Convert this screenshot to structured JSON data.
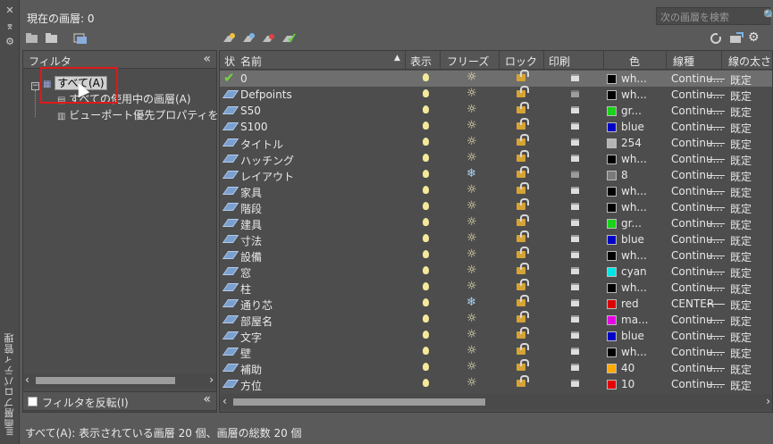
{
  "side_panel": {
    "title": "画層プロパティ管理"
  },
  "header": {
    "current_layer": "現在の画層: 0",
    "search_placeholder": "次の画層を検索"
  },
  "filter": {
    "title": "フィルタ",
    "tree": [
      {
        "label": "すべて(A)"
      },
      {
        "label": "すべての使用中の画層(A)"
      },
      {
        "label": "ビューポート優先プロパティを含む画"
      }
    ],
    "invert_label": "フィルタを反転(I)"
  },
  "columns": [
    "状",
    "名前",
    "表示",
    "フリーズ",
    "ロック",
    "印刷",
    "色",
    "線種",
    "線の太さ"
  ],
  "layers": [
    {
      "name": "0",
      "color_name": "wh...",
      "color_hex": "#000000",
      "linetype": "Continu...",
      "lineweight": "既定",
      "frozen": false,
      "plot": true,
      "current": true
    },
    {
      "name": "Defpoints",
      "color_name": "wh...",
      "color_hex": "#000000",
      "linetype": "Continu...",
      "lineweight": "既定",
      "frozen": false,
      "plot": false
    },
    {
      "name": "S50",
      "color_name": "gr...",
      "color_hex": "#19d219",
      "linetype": "Continu...",
      "lineweight": "既定",
      "frozen": false,
      "plot": true
    },
    {
      "name": "S100",
      "color_name": "blue",
      "color_hex": "#0000c8",
      "linetype": "Continu...",
      "lineweight": "既定",
      "frozen": false,
      "plot": true
    },
    {
      "name": "タイトル",
      "color_name": "254",
      "color_hex": "#b4b4b4",
      "linetype": "Continu...",
      "lineweight": "既定",
      "frozen": false,
      "plot": true
    },
    {
      "name": "ハッチング",
      "color_name": "wh...",
      "color_hex": "#000000",
      "linetype": "Continu...",
      "lineweight": "既定",
      "frozen": false,
      "plot": true
    },
    {
      "name": "レイアウト",
      "color_name": "8",
      "color_hex": "#7a7a7a",
      "linetype": "Continu...",
      "lineweight": "既定",
      "frozen": true,
      "plot": false
    },
    {
      "name": "家具",
      "color_name": "wh...",
      "color_hex": "#000000",
      "linetype": "Continu...",
      "lineweight": "既定",
      "frozen": false,
      "plot": true
    },
    {
      "name": "階段",
      "color_name": "wh...",
      "color_hex": "#000000",
      "linetype": "Continu...",
      "lineweight": "既定",
      "frozen": false,
      "plot": true
    },
    {
      "name": "建具",
      "color_name": "gr...",
      "color_hex": "#19d219",
      "linetype": "Continu...",
      "lineweight": "既定",
      "frozen": false,
      "plot": true
    },
    {
      "name": "寸法",
      "color_name": "blue",
      "color_hex": "#0000c8",
      "linetype": "Continu...",
      "lineweight": "既定",
      "frozen": false,
      "plot": true
    },
    {
      "name": "設備",
      "color_name": "wh...",
      "color_hex": "#000000",
      "linetype": "Continu...",
      "lineweight": "既定",
      "frozen": false,
      "plot": true
    },
    {
      "name": "窓",
      "color_name": "cyan",
      "color_hex": "#00e6e6",
      "linetype": "Continu...",
      "lineweight": "既定",
      "frozen": false,
      "plot": true
    },
    {
      "name": "柱",
      "color_name": "wh...",
      "color_hex": "#000000",
      "linetype": "Continu...",
      "lineweight": "既定",
      "frozen": false,
      "plot": true
    },
    {
      "name": "通り芯",
      "color_name": "red",
      "color_hex": "#dc0000",
      "linetype": "CENTER",
      "lineweight": "既定",
      "frozen": true,
      "plot": true
    },
    {
      "name": "部屋名",
      "color_name": "ma...",
      "color_hex": "#e600e6",
      "linetype": "Continu...",
      "lineweight": "既定",
      "frozen": false,
      "plot": true
    },
    {
      "name": "文字",
      "color_name": "blue",
      "color_hex": "#0000c8",
      "linetype": "Continu...",
      "lineweight": "既定",
      "frozen": false,
      "plot": true
    },
    {
      "name": "壁",
      "color_name": "wh...",
      "color_hex": "#000000",
      "linetype": "Continu...",
      "lineweight": "既定",
      "frozen": false,
      "plot": true
    },
    {
      "name": "補助",
      "color_name": "40",
      "color_hex": "#ffaa00",
      "linetype": "Continu...",
      "lineweight": "既定",
      "frozen": false,
      "plot": true
    },
    {
      "name": "方位",
      "color_name": "10",
      "color_hex": "#e60000",
      "linetype": "Continu...",
      "lineweight": "既定",
      "frozen": false,
      "plot": true
    }
  ],
  "status": "すべて(A): 表示されている画層 20 個、画層の総数 20 個",
  "colors": {
    "panel": "#5a5a5a",
    "grid": "#4d4d4d",
    "selected_row": "#6e6e6e",
    "highlight_box": "#e01818"
  }
}
